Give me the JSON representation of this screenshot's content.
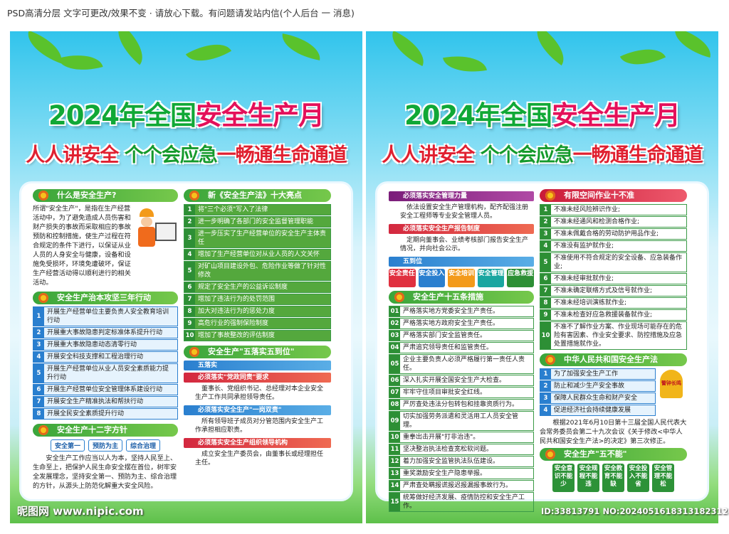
{
  "top_bar": "PSD高清分层 文字可更改/效果不变 · 请放心下载。有问题请发站内信(个人后台 一 消息)",
  "title": "2024年全国安全生产月",
  "title_a": "2024年全国",
  "title_b": "安全生产月",
  "subtitle_a": "人人讲安全",
  "subtitle_b": "个个会应急",
  "subtitle_c": "一畅通生命通道",
  "left": {
    "s1": {
      "title": "什么是安全生产?",
      "text": "所谓\"安全生产\"，是指在生产经营活动中，为了避免造成人员伤害和财产损失的事故而采取相应的事故预防和控制措施，使生产过程在符合规定的条件下进行，以保证从业人员的人身安全与健康，设备和设施免受损坏，环境免遭破坏，保证生产经营活动得以顺利进行的相关活动。"
    },
    "s2": {
      "title": "安全生产治本攻坚三年行动",
      "items": [
        "开展生产经营单位主要负责人安全教育培训行动",
        "开展重大事故隐患判定标准体系提升行动",
        "开展重大事故隐患动态清零行动",
        "开展安全科技支撑和工程治理行动",
        "开展生产经营单位从业人员安全素质能力提升行动",
        "开展生产经营单位安全管理体系建设行动",
        "开展安全生产精准执法和帮扶行动",
        "开展全民安全素质提升行动"
      ]
    },
    "s3": {
      "title": "安全生产十二字方针",
      "pills": [
        "安全第一",
        "预防为主",
        "综合治理"
      ],
      "text": "安全生产工作应当以人为本，坚持人民至上、生命至上，把保护人民生命安全摆在首位，树牢安全发展理念，坚持安全第一、预防为主、综合治理的方针，从源头上防范化解重大安全风险。"
    },
    "s4": {
      "title": "新《安全生产法》十大亮点",
      "items": [
        "将\"三个必须\"写入了法律",
        "进一步明确了各部门的安全监督管理职能",
        "进一步压实了生产经营单位的安全生产主体责任",
        "增加了生产经营单位对从业人员的人文关怀",
        "对矿山项目建设外包、危险作业等做了针对性修改",
        "规定了安全生产的公益诉讼制度",
        "增加了违法行为的处罚范围",
        "加大对违法行为的惩处力度",
        "高危行业的强制保险制度",
        "增加了事故整改的评估制度"
      ]
    },
    "s5": {
      "title": "安全生产\"五落实五到位\"",
      "sub": "五落实",
      "items": [
        {
          "h": "必须落实\"党政同责\"要求",
          "t": "董事长、党组织书记、总经理对本企业安全生产工作共同承担领导责任。"
        },
        {
          "h": "必须落实安全生产\"一岗双责\"",
          "t": "所有领导班子成员对分管范围内安全生产工作承担相应职责。"
        },
        {
          "h": "必须落实安全生产组织领导机构",
          "t": "成立安全生产委员会，由董事长或经理担任主任。"
        }
      ]
    }
  },
  "right": {
    "r1": [
      {
        "h": "必须落实安全管理力量",
        "t": "依法设置安全生产管理机构，配齐配强注册安全工程师等专业安全管理人员。"
      },
      {
        "h": "必须落实安全生产报告制度",
        "t": "定期向董事会、业绩考核部门报告安全生产情况，并向社会公示。"
      }
    ],
    "wdw": {
      "title": "五到位",
      "tags": [
        "安全责任",
        "安全投入",
        "安全培训",
        "安全管理",
        "应急救援"
      ]
    },
    "s15": {
      "title": "安全生产十五条措施",
      "items": [
        "严格落实地方党委安全生产责任。",
        "严格落实地方政府安全生产责任。",
        "严格落实部门安全监管责任。",
        "严肃追究领导责任和监管责任。",
        "企业主要负责人必须严格履行第一责任人责任。",
        "深入扎实开展全国安全生产大检查。",
        "牢牢守住项目审批安全红线。",
        "严厉查处违法分包转包和挂靠资质行为。",
        "切实加强劳务派遣和灵活用工人员安全管理。",
        "重拳出击开展\"打非治违\"。",
        "坚决整治执法检查宽松软问题。",
        "着力加强安全监管执法队伍建设。",
        "重奖激励安全生产隐患举报。",
        "严肃查处瞒报谎报迟报漏报事故行为。",
        "统筹做好经济发展、疫情防控和安全生产工作。"
      ]
    },
    "s10": {
      "title": "有限空间作业十不准",
      "items": [
        "不准未经风险辨识作业;",
        "不准未经通风和检测合格作业;",
        "不准未佩戴合格的劳动防护用品作业;",
        "不准没有监护就作业;",
        "不准使用不符合规定的安全设备、应急装备作业;",
        "不准未经审批就作业;",
        "不准未确定联络方式及信号就作业;",
        "不准未经培训演练就作业;",
        "不准未检查好应急救援装备就作业;",
        "不准不了解作业方案、作业现场可能存在的危险有害因素、作业安全要求、防控措施及应急处置措施就作业。"
      ]
    },
    "law": {
      "title": "中华人民共和国安全生产法",
      "items": [
        "为了加强安全生产工作",
        "防止和减少生产安全事故",
        "保障人民群众生命和财产安全",
        "促进经济社会持续健康发展"
      ],
      "text": "根据2021年6月10日第十三届全国人民代表大会常务委员会第二十九次会议《关于修改<中华人民共和国安全生产法>的决定》第三次修正。",
      "bell": "警钟长鸣"
    },
    "wbn": {
      "title": "安全生产\"五不能\"",
      "items": [
        "安全意识不能少",
        "安全规程不能违",
        "安全教育不能缺",
        "安全投入不能省",
        "安全管理不能松"
      ]
    }
  },
  "footer_left": "昵图网 www.nipic.com",
  "footer_right": "ID:33813791 NO:20240516183131823120"
}
